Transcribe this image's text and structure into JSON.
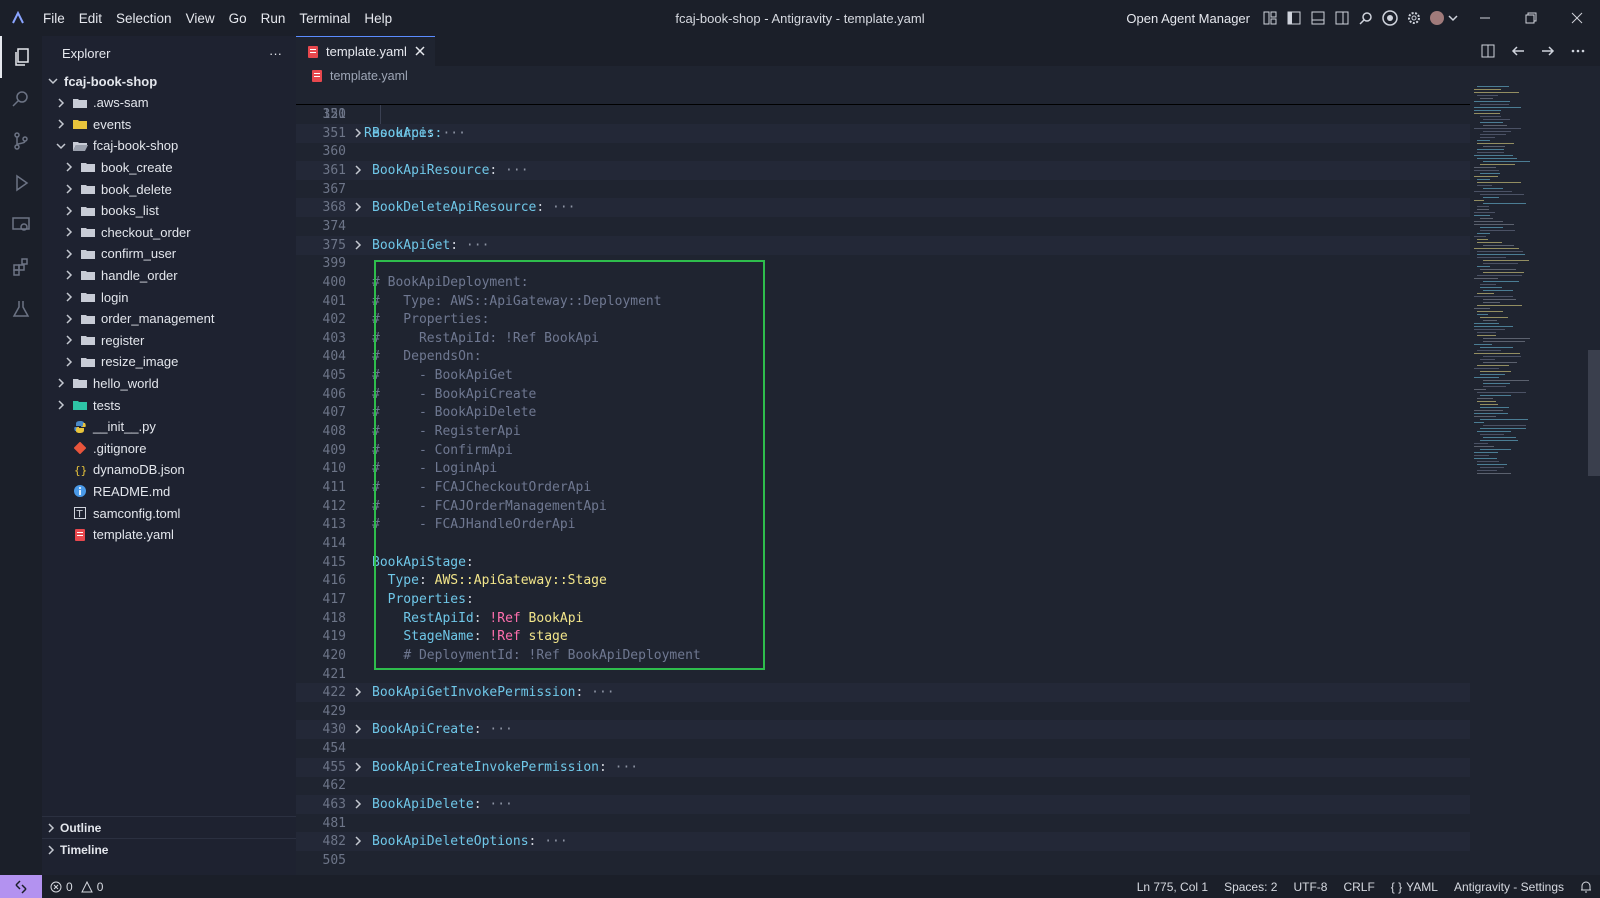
{
  "window": {
    "title": "fcaj-book-shop - Antigravity - template.yaml",
    "agent_manager_label": "Open Agent Manager"
  },
  "menu": [
    "File",
    "Edit",
    "Selection",
    "View",
    "Go",
    "Run",
    "Terminal",
    "Help"
  ],
  "sidebar": {
    "header": "Explorer",
    "more_label": "···",
    "tree": [
      {
        "label": "fcaj-book-shop",
        "depth": 0,
        "kind": "root",
        "expanded": true
      },
      {
        "label": ".aws-sam",
        "depth": 1,
        "kind": "folder",
        "expanded": false
      },
      {
        "label": "events",
        "depth": 1,
        "kind": "folder-yellow",
        "expanded": false
      },
      {
        "label": "fcaj-book-shop",
        "depth": 1,
        "kind": "folder-open",
        "expanded": true
      },
      {
        "label": "book_create",
        "depth": 2,
        "kind": "folder",
        "expanded": false
      },
      {
        "label": "book_delete",
        "depth": 2,
        "kind": "folder",
        "expanded": false
      },
      {
        "label": "books_list",
        "depth": 2,
        "kind": "folder",
        "expanded": false
      },
      {
        "label": "checkout_order",
        "depth": 2,
        "kind": "folder",
        "expanded": false
      },
      {
        "label": "confirm_user",
        "depth": 2,
        "kind": "folder",
        "expanded": false
      },
      {
        "label": "handle_order",
        "depth": 2,
        "kind": "folder",
        "expanded": false
      },
      {
        "label": "login",
        "depth": 2,
        "kind": "folder",
        "expanded": false
      },
      {
        "label": "order_management",
        "depth": 2,
        "kind": "folder",
        "expanded": false
      },
      {
        "label": "register",
        "depth": 2,
        "kind": "folder",
        "expanded": false
      },
      {
        "label": "resize_image",
        "depth": 2,
        "kind": "folder",
        "expanded": false
      },
      {
        "label": "hello_world",
        "depth": 1,
        "kind": "folder",
        "expanded": false
      },
      {
        "label": "tests",
        "depth": 1,
        "kind": "folder-teal",
        "expanded": false
      },
      {
        "label": "__init__.py",
        "depth": 1,
        "kind": "python"
      },
      {
        "label": ".gitignore",
        "depth": 1,
        "kind": "git"
      },
      {
        "label": "dynamoDB.json",
        "depth": 1,
        "kind": "json"
      },
      {
        "label": "README.md",
        "depth": 1,
        "kind": "info"
      },
      {
        "label": "samconfig.toml",
        "depth": 1,
        "kind": "toml"
      },
      {
        "label": "template.yaml",
        "depth": 1,
        "kind": "yaml"
      }
    ],
    "sections": [
      "Outline",
      "Timeline"
    ]
  },
  "tabs": [
    {
      "label": "template.yaml",
      "active": true
    }
  ],
  "breadcrumb": "template.yaml",
  "editor": {
    "sticky_line": {
      "num": "121",
      "text": "Resources:"
    },
    "lines": [
      {
        "num": "350",
        "fold": false,
        "parts": []
      },
      {
        "num": "351",
        "fold": true,
        "folded": true,
        "parts": [
          [
            "k",
            "BookApi"
          ],
          [
            "p",
            ":"
          ],
          [
            "dots",
            " ···"
          ]
        ]
      },
      {
        "num": "360",
        "fold": false,
        "parts": []
      },
      {
        "num": "361",
        "fold": true,
        "folded": true,
        "parts": [
          [
            "k",
            "BookApiResource"
          ],
          [
            "p",
            ":"
          ],
          [
            "dots",
            " ···"
          ]
        ]
      },
      {
        "num": "367",
        "fold": false,
        "parts": []
      },
      {
        "num": "368",
        "fold": true,
        "folded": true,
        "parts": [
          [
            "k",
            "BookDeleteApiResource"
          ],
          [
            "p",
            ":"
          ],
          [
            "dots",
            " ···"
          ]
        ]
      },
      {
        "num": "374",
        "fold": false,
        "parts": []
      },
      {
        "num": "375",
        "fold": true,
        "folded": true,
        "parts": [
          [
            "k",
            "BookApiGet"
          ],
          [
            "p",
            ":"
          ],
          [
            "dots",
            " ···"
          ]
        ]
      },
      {
        "num": "399",
        "fold": false,
        "parts": []
      },
      {
        "num": "400",
        "fold": false,
        "parts": [
          [
            "c",
            "# BookApiDeployment:"
          ]
        ]
      },
      {
        "num": "401",
        "fold": false,
        "parts": [
          [
            "c",
            "#   Type: AWS::ApiGateway::Deployment"
          ]
        ]
      },
      {
        "num": "402",
        "fold": false,
        "parts": [
          [
            "c",
            "#   Properties:"
          ]
        ]
      },
      {
        "num": "403",
        "fold": false,
        "parts": [
          [
            "c",
            "#     RestApiId: !Ref BookApi"
          ]
        ]
      },
      {
        "num": "404",
        "fold": false,
        "parts": [
          [
            "c",
            "#   DependsOn:"
          ]
        ]
      },
      {
        "num": "405",
        "fold": false,
        "parts": [
          [
            "c",
            "#     - BookApiGet"
          ]
        ]
      },
      {
        "num": "406",
        "fold": false,
        "parts": [
          [
            "c",
            "#     - BookApiCreate"
          ]
        ]
      },
      {
        "num": "407",
        "fold": false,
        "parts": [
          [
            "c",
            "#     - BookApiDelete"
          ]
        ]
      },
      {
        "num": "408",
        "fold": false,
        "parts": [
          [
            "c",
            "#     - RegisterApi"
          ]
        ]
      },
      {
        "num": "409",
        "fold": false,
        "parts": [
          [
            "c",
            "#     - ConfirmApi"
          ]
        ]
      },
      {
        "num": "410",
        "fold": false,
        "parts": [
          [
            "c",
            "#     - LoginApi"
          ]
        ]
      },
      {
        "num": "411",
        "fold": false,
        "parts": [
          [
            "c",
            "#     - FCAJCheckoutOrderApi"
          ]
        ]
      },
      {
        "num": "412",
        "fold": false,
        "parts": [
          [
            "c",
            "#     - FCAJOrderManagementApi"
          ]
        ]
      },
      {
        "num": "413",
        "fold": false,
        "parts": [
          [
            "c",
            "#     - FCAJHandleOrderApi"
          ]
        ]
      },
      {
        "num": "414",
        "fold": false,
        "parts": []
      },
      {
        "num": "415",
        "fold": false,
        "parts": [
          [
            "k",
            "BookApiStage"
          ],
          [
            "p",
            ":"
          ]
        ]
      },
      {
        "num": "416",
        "fold": false,
        "parts": [
          [
            "p",
            "  "
          ],
          [
            "k",
            "Type"
          ],
          [
            "p",
            ": "
          ],
          [
            "s",
            "AWS::ApiGateway::Stage"
          ]
        ]
      },
      {
        "num": "417",
        "fold": false,
        "parts": [
          [
            "p",
            "  "
          ],
          [
            "k",
            "Properties"
          ],
          [
            "p",
            ":"
          ]
        ]
      },
      {
        "num": "418",
        "fold": false,
        "parts": [
          [
            "p",
            "    "
          ],
          [
            "k",
            "RestApiId"
          ],
          [
            "p",
            ": "
          ],
          [
            "t",
            "!Ref"
          ],
          [
            "s",
            " BookApi"
          ]
        ]
      },
      {
        "num": "419",
        "fold": false,
        "parts": [
          [
            "p",
            "    "
          ],
          [
            "k",
            "StageName"
          ],
          [
            "p",
            ": "
          ],
          [
            "t",
            "!Ref"
          ],
          [
            "s",
            " stage"
          ]
        ]
      },
      {
        "num": "420",
        "fold": false,
        "parts": [
          [
            "p",
            "    "
          ],
          [
            "c",
            "# DeploymentId: !Ref BookApiDeployment"
          ]
        ]
      },
      {
        "num": "421",
        "fold": false,
        "parts": []
      },
      {
        "num": "422",
        "fold": true,
        "folded": true,
        "parts": [
          [
            "k",
            "BookApiGetInvokePermission"
          ],
          [
            "p",
            ":"
          ],
          [
            "dots",
            " ···"
          ]
        ]
      },
      {
        "num": "429",
        "fold": false,
        "parts": []
      },
      {
        "num": "430",
        "fold": true,
        "folded": true,
        "parts": [
          [
            "k",
            "BookApiCreate"
          ],
          [
            "p",
            ":"
          ],
          [
            "dots",
            " ···"
          ]
        ]
      },
      {
        "num": "454",
        "fold": false,
        "parts": []
      },
      {
        "num": "455",
        "fold": true,
        "folded": true,
        "parts": [
          [
            "k",
            "BookApiCreateInvokePermission"
          ],
          [
            "p",
            ":"
          ],
          [
            "dots",
            " ···"
          ]
        ]
      },
      {
        "num": "462",
        "fold": false,
        "parts": []
      },
      {
        "num": "463",
        "fold": true,
        "folded": true,
        "parts": [
          [
            "k",
            "BookApiDelete"
          ],
          [
            "p",
            ":"
          ],
          [
            "dots",
            " ···"
          ]
        ]
      },
      {
        "num": "481",
        "fold": false,
        "parts": []
      },
      {
        "num": "482",
        "fold": true,
        "folded": true,
        "parts": [
          [
            "k",
            "BookApiDeleteOptions"
          ],
          [
            "p",
            ":"
          ],
          [
            "dots",
            " ···"
          ]
        ]
      },
      {
        "num": "505",
        "fold": false,
        "parts": []
      }
    ]
  },
  "status": {
    "errors": "0",
    "warnings": "0",
    "cursor": "Ln 775, Col 1",
    "spaces": "Spaces: 2",
    "encoding": "UTF-8",
    "eol": "CRLF",
    "language": "YAML",
    "settings": "Antigravity - Settings"
  },
  "colors": {
    "highlight_box": "#2ebd4c",
    "yaml_key": "#6fc7e8",
    "yaml_comment": "#6f7891",
    "yaml_string": "#f2e58a",
    "yaml_tag": "#ff6fae",
    "remote_button": "#b392f0"
  }
}
